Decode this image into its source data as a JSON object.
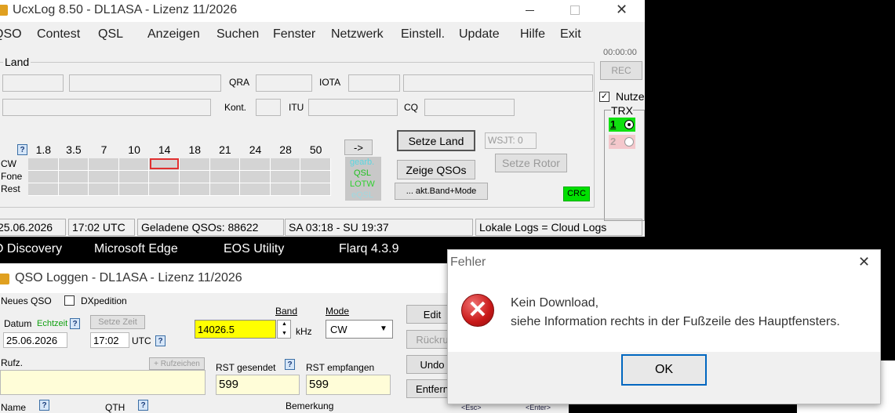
{
  "main_window": {
    "title": "UcxLog 8.50  - DL1ASA - Lizenz 11/2026",
    "menu": [
      "QSO",
      "Contest",
      "QSL",
      "Anzeigen",
      "Suchen",
      "Fenster",
      "Netzwerk",
      "Einstell.",
      "Update",
      "Hilfe",
      "Exit"
    ],
    "group_label": "Land",
    "labels": {
      "qra": "QRA",
      "iota": "IOTA",
      "kont": "Kont.",
      "itu": "ITU",
      "cq": "CQ"
    },
    "bands": [
      "1.8",
      "3.5",
      "7",
      "10",
      "14",
      "18",
      "21",
      "24",
      "28",
      "50"
    ],
    "modes": [
      "CW",
      "Fone",
      "Rest"
    ],
    "arrow_button": "->",
    "legend": {
      "gearb": "gearb.",
      "qsl": "QSL",
      "lotw": "LOTW",
      "eqsl": "eQSL"
    },
    "buttons": {
      "setze_land": "Setze Land",
      "zeige_qsos": "Zeige QSOs",
      "akt_band": "... akt.Band+Mode",
      "setze_rotor": "Setze Rotor",
      "wsjt": "WSJT: 0",
      "crc": "CRC"
    },
    "right_panel": {
      "timer": "00:00:00",
      "rec": "REC",
      "nutze": "Nutze",
      "trx": "TRX",
      "trx1": "1",
      "trx2": "2"
    },
    "status": {
      "date": "25.06.2026",
      "utc": "17:02 UTC",
      "loaded": "Geladene QSOs: 88622",
      "sun": "SA 03:18 - SU 19:37",
      "cloud": "Lokale Logs = Cloud Logs"
    }
  },
  "taskbar": [
    "O Discovery",
    "Microsoft Edge",
    "EOS Utility",
    "Flarq 4.3.9"
  ],
  "qso_window": {
    "title": "QSO Loggen - DL1ASA - Lizenz 11/2026",
    "neues_qso": "Neues QSO",
    "dxpedition": "DXpedition",
    "datum": "Datum",
    "echtzeit": "Echtzeit",
    "setze_zeit": "Setze Zeit",
    "date_value": "25.06.2026",
    "time_value": "17:02",
    "utc": "UTC",
    "band_label": "Band",
    "freq": "14026.5",
    "khz": "kHz",
    "mode_label": "Mode",
    "mode_value": "CW",
    "rufz": "Rufz.",
    "rufzeichen_btn": "+ Rufzeichen",
    "rst_sent_label": "RST gesendet",
    "rst_recv_label": "RST empfangen",
    "rst_sent": "599",
    "rst_recv": "599",
    "name": "Name",
    "qth": "QTH",
    "bemerkung": "Bemerkung",
    "buttons": {
      "edit": "Edit",
      "rueck": "Rückru",
      "undo": "Undo",
      "entfern": "Entfern"
    },
    "esc": "<Esc>",
    "enter": "<Enter>"
  },
  "error_dialog": {
    "title": "Fehler",
    "line1": "Kein Download,",
    "line2": "siehe Information rechts in der Fußzeile des Hauptfensters.",
    "ok": "OK"
  }
}
